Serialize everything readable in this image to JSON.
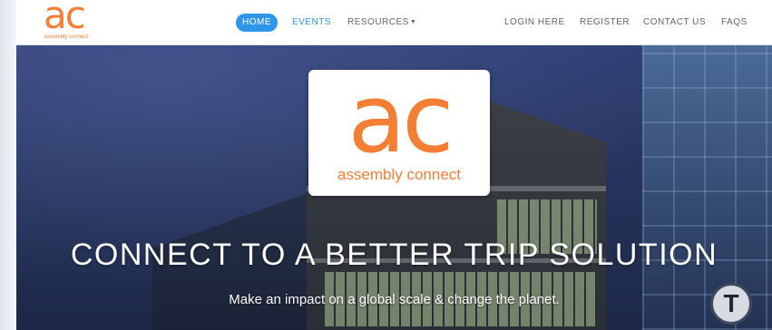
{
  "brand": {
    "logo_mark": "ac",
    "logo_text": "assembly connect",
    "color": "#f47e33"
  },
  "nav": {
    "home": "HOME",
    "events": "EVENTS",
    "resources": "RESOURCES",
    "login": "LOGIN HERE",
    "register": "REGISTER",
    "contact": "CONTACT US",
    "faqs": "FAQS",
    "active_color": "#2f95e8"
  },
  "hero": {
    "logo_mark": "ac",
    "logo_text": "assembly connect",
    "headline": "CONNECT TO A BETTER TRIP SOLUTION",
    "subline": "Make an impact on a global scale & change the planet.",
    "transit_sign": "T"
  }
}
